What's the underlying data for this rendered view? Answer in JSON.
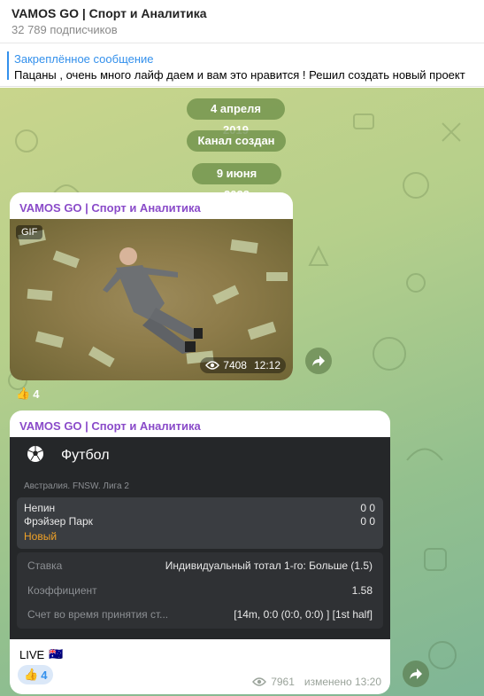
{
  "header": {
    "title": "VAMOS GO | Спорт и Аналитика",
    "subscribers": "32 789 подписчиков"
  },
  "pinned": {
    "label": "Закреплённое сообщение",
    "text": "Пацаны , очень много лайф даем и вам это нравится !   Решил создать новый проект"
  },
  "service": {
    "date1": "4 апреля 2019",
    "created": "Канал создан",
    "date2": "9 июня 2023"
  },
  "post1": {
    "sender": "VAMOS GO | Спорт и Аналитика",
    "gif_badge": "GIF",
    "views": "7408",
    "time": "12:12",
    "reaction_emoji": "👍",
    "reaction_count": "4"
  },
  "post2": {
    "sender": "VAMOS GO | Спорт и Аналитика",
    "sport": "Футбол",
    "league": "Австралия. FNSW. Лига 2",
    "team1": "Непин",
    "team1_score": "0  0",
    "team2": "Фрэйзер Парк",
    "team2_score": "0  0",
    "status": "Новый",
    "rows": [
      {
        "label": "Ставка",
        "value": "Индивидуальный тотал 1-го: Больше (1.5)"
      },
      {
        "label": "Коэффициент",
        "value": "1.58"
      },
      {
        "label": "Счет во время принятия ст...",
        "value": "[14m, 0:0 (0:0, 0:0) ] [1st half]"
      }
    ],
    "caption": "LIVE",
    "flag": "🇦🇺",
    "reaction_emoji": "👍",
    "reaction_count": "4",
    "views": "7961",
    "edited": "изменено 13:20"
  },
  "colors": {
    "accent": "#3390ec",
    "sender": "#8a4bc9",
    "status": "#f0a227"
  },
  "icons": [
    "eye-icon",
    "share-icon",
    "soccer-ball-icon"
  ]
}
